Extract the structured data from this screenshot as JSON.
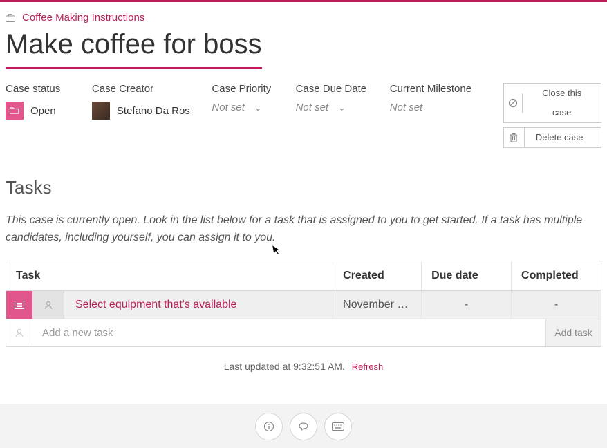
{
  "breadcrumb": {
    "link": "Coffee Making Instructions"
  },
  "title": "Make coffee for boss",
  "meta": {
    "status": {
      "label": "Case status",
      "value": "Open"
    },
    "creator": {
      "label": "Case Creator",
      "value": "Stefano Da Ros"
    },
    "priority": {
      "label": "Case Priority",
      "value": "Not set"
    },
    "due": {
      "label": "Case Due Date",
      "value": "Not set"
    },
    "milestone": {
      "label": "Current Milestone",
      "value": "Not set"
    }
  },
  "actions": {
    "close": "Close this case",
    "delete": "Delete case"
  },
  "tasks_header": "Tasks",
  "tasks_hint": "This case is currently open. Look in the list below for a task that is assigned to you to get started. If a task has multiple candidates, including yourself, you can assign it to you.",
  "table": {
    "cols": {
      "task": "Task",
      "created": "Created",
      "due": "Due date",
      "completed": "Completed"
    },
    "rows": [
      {
        "name": "Select equipment that's available",
        "created": "November …",
        "due": "-",
        "completed": "-"
      }
    ],
    "add_placeholder": "Add a new task",
    "add_button": "Add task"
  },
  "updated": {
    "prefix": "Last updated at ",
    "time": "9:32:51 AM.",
    "refresh": "Refresh"
  }
}
